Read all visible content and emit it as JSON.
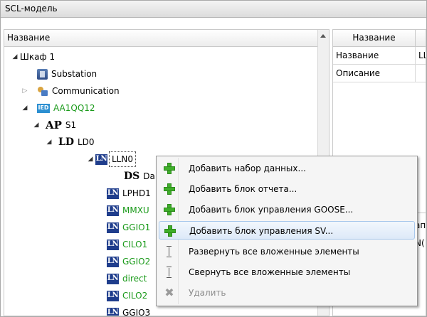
{
  "window": {
    "title": "SCL-модель"
  },
  "tree": {
    "header": "Название",
    "nodes": [
      {
        "label": "Шкаф 1"
      },
      {
        "label": "Substation"
      },
      {
        "label": "Communication"
      },
      {
        "label": "AA1QQ12"
      },
      {
        "icon_text": "AP",
        "label": "S1"
      },
      {
        "icon_text": "LD",
        "label": "LD0"
      },
      {
        "icon_text": "LN",
        "label": "LLN0"
      },
      {
        "icon_text": "DS",
        "label": "Da"
      },
      {
        "icon_text": "LN",
        "label": "LPHD1"
      },
      {
        "icon_text": "LN",
        "label": "MMXU"
      },
      {
        "icon_text": "LN",
        "label": "GGIO1"
      },
      {
        "icon_text": "LN",
        "label": "CILO1"
      },
      {
        "icon_text": "LN",
        "label": "GGIO2"
      },
      {
        "icon_text": "LN",
        "label": "direct"
      },
      {
        "icon_text": "LN",
        "label": "CILO2"
      },
      {
        "icon_text": "LN",
        "label": "GGIO3"
      }
    ]
  },
  "props": {
    "header": "Название",
    "rows": [
      {
        "key": "Название",
        "value": "LL"
      },
      {
        "key": "Описание",
        "value": ""
      }
    ],
    "fragments": [
      "ап",
      "N("
    ]
  },
  "context_menu": {
    "items": [
      {
        "label": "Добавить набор данных...",
        "icon": "add-icon"
      },
      {
        "label": "Добавить блок отчета...",
        "icon": "add-icon"
      },
      {
        "label": "Добавить блок управления GOOSE...",
        "icon": "add-icon"
      },
      {
        "label": "Добавить блок управления SV...",
        "icon": "add-icon"
      },
      {
        "label": "Развернуть все вложенные элементы",
        "icon": "expand-all-icon"
      },
      {
        "label": "Свернуть все вложенные элементы",
        "icon": "collapse-all-icon"
      },
      {
        "label": "Удалить",
        "icon": "delete-icon"
      }
    ]
  }
}
